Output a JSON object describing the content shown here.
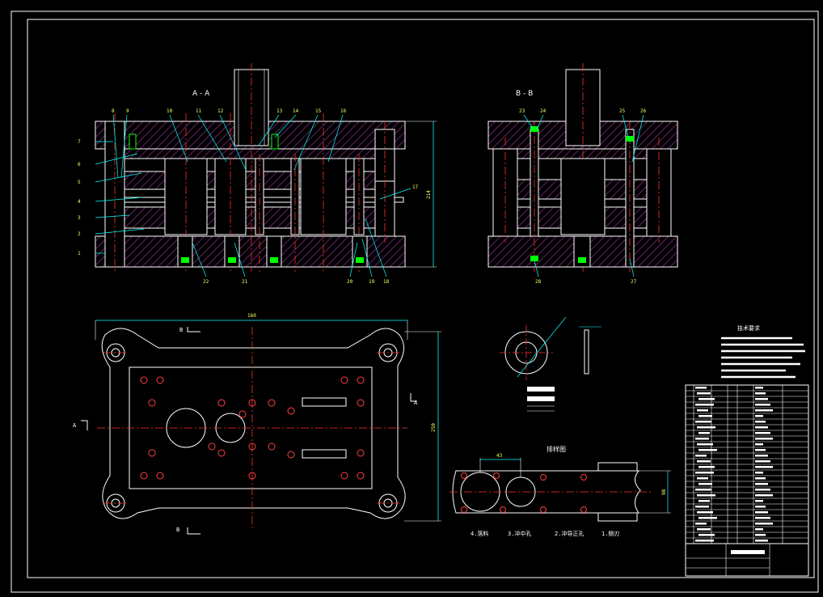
{
  "section_labels": {
    "aa": "A - A",
    "bb": "B - B"
  },
  "view_markers": {
    "a": "A",
    "b": "B"
  },
  "callouts_aa_top": [
    "8",
    "9",
    "10",
    "11",
    "12",
    "13",
    "14",
    "15",
    "16"
  ],
  "callouts_aa_left": [
    "7",
    "6",
    "5",
    "4",
    "3",
    "2",
    "1"
  ],
  "callout_aa_right": "17",
  "callouts_aa_bottom": [
    "22",
    "21",
    "20",
    "19",
    "18"
  ],
  "callouts_bb_top": [
    "23",
    "24",
    "25",
    "26"
  ],
  "callouts_bb_bottom": [
    "28",
    "27"
  ],
  "dim_aa_height": "214",
  "dim_plan_width": "160",
  "dim_plan_height": "250",
  "strip": {
    "title": "排样图",
    "dim_pitch": "43",
    "dim_width": "98",
    "steps": [
      "4.落料",
      "3.冲中孔",
      "2.冲导正孔",
      "1.侧刃"
    ]
  },
  "tech_title": "技术要求",
  "colors": {
    "hatch": "#b040b0",
    "green": "#00ff00",
    "cyan": "#00ffff",
    "red": "#ff3030",
    "white": "#ffffff",
    "yellow": "#ffff00"
  }
}
